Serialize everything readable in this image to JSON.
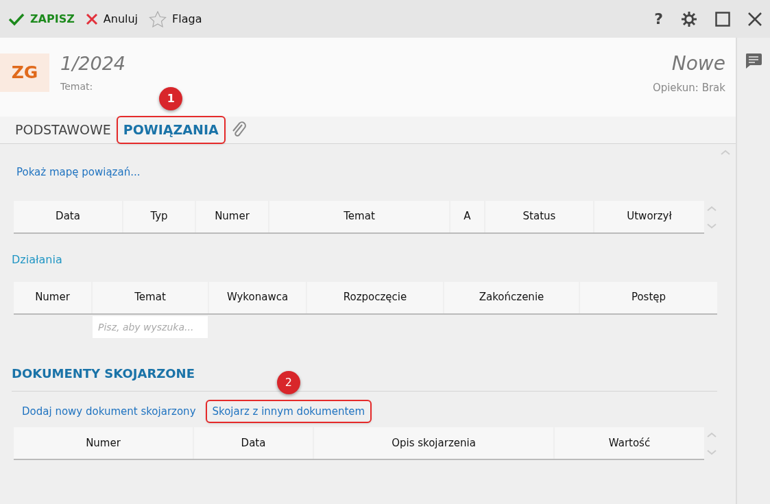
{
  "toolbar": {
    "save": "ZAPISZ",
    "cancel": "Anuluj",
    "flag": "Flaga",
    "help": "?"
  },
  "header": {
    "badge": "ZG",
    "number": "1/2024",
    "subject_label": "Temat:",
    "status": "Nowe",
    "owner": "Opiekun: Brak"
  },
  "tabs": [
    {
      "label": "PODSTAWOWE",
      "selected": false
    },
    {
      "label": "POWIĄZANIA",
      "selected": true,
      "callout": "1"
    }
  ],
  "relations": {
    "map_link": "Pokaż mapę powiązań...",
    "columns": [
      "Data",
      "Typ",
      "Numer",
      "Temat",
      "A",
      "Status",
      "Utworzył"
    ]
  },
  "actions": {
    "title": "Działania",
    "columns": [
      "Numer",
      "Temat",
      "Wykonawca",
      "Rozpoczęcie",
      "Zakończenie",
      "Postęp"
    ],
    "search": {
      "placeholder": "Pisz, aby wyszuka..."
    }
  },
  "linked_documents": {
    "title": "DOKUMENTY SKOJARZONE",
    "links": [
      {
        "label": "Dodaj nowy dokument skojarzony"
      },
      {
        "label": "Skojarz z innym dokumentem",
        "callout": "2"
      }
    ],
    "columns": [
      "Numer",
      "Data",
      "Opis skojarzenia",
      "Wartość"
    ]
  }
}
